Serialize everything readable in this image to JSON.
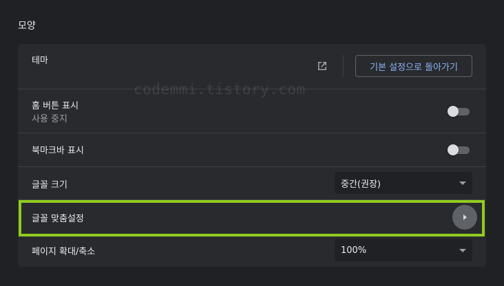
{
  "section": {
    "title": "모양"
  },
  "theme": {
    "label": "테마",
    "open_icon": "open-in-new-icon",
    "reset_label": "기본 설정으로 돌아가기"
  },
  "home_button": {
    "label": "홈 버튼 표시",
    "sublabel": "사용 중지",
    "enabled": false
  },
  "bookmarks_bar": {
    "label": "북마크바 표시",
    "enabled": false
  },
  "font_size": {
    "label": "글꼴 크기",
    "value": "중간(권장)"
  },
  "customize_fonts": {
    "label": "글꼴 맞춤설정",
    "icon": "arrow-right-icon"
  },
  "page_zoom": {
    "label": "페이지 확대/축소",
    "value": "100%"
  },
  "watermark": {
    "text": "codemmi.tistory.com"
  },
  "colors": {
    "background": "#202124",
    "card": "#292a2d",
    "accent": "#8ab4f8",
    "highlight": "#8fcc1f"
  }
}
